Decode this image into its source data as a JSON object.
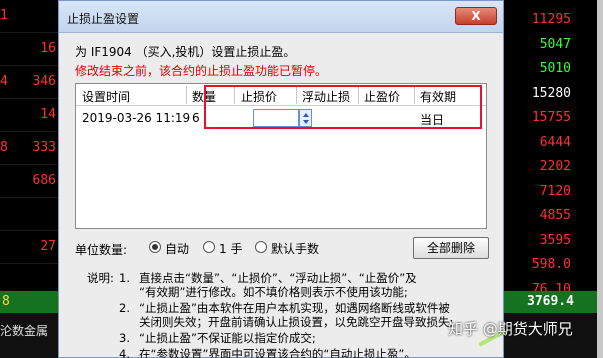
{
  "background": {
    "left_column": [
      {
        "idx": "1",
        "num": "",
        "color": "#ff3030"
      },
      {
        "idx": "",
        "num": "",
        "color": "#ff3030"
      },
      {
        "idx": "4",
        "num": "346",
        "color": "#ff3030"
      },
      {
        "idx": "",
        "num": "",
        "color": "#ff3030"
      },
      {
        "idx": "8",
        "num": "333",
        "color": "#ff3030"
      },
      {
        "idx": "",
        "num": "",
        "color": "#ff3030"
      },
      {
        "idx": "",
        "num": "",
        "color": "#ff3030"
      },
      {
        "idx": "",
        "num": "",
        "color": "#ff3030"
      },
      {
        "idx": "",
        "num": "",
        "color": "#ff3030"
      }
    ],
    "left_extra": [
      "16",
      "14",
      "686",
      "27"
    ],
    "right_column": [
      {
        "value": "11295",
        "color": "#ff3030"
      },
      {
        "value": "5047",
        "color": "#33ff33"
      },
      {
        "value": "5010",
        "color": "#33ff33"
      },
      {
        "value": "15280",
        "color": "#ffffff"
      },
      {
        "value": "15755",
        "color": "#ff3030"
      },
      {
        "value": "6444",
        "color": "#ff3030"
      },
      {
        "value": "2202",
        "color": "#ff3030"
      },
      {
        "value": "7120",
        "color": "#ff3030"
      },
      {
        "value": "4855",
        "color": "#ff3030"
      },
      {
        "value": "3595",
        "color": "#ff3030"
      },
      {
        "value": "598.0",
        "color": "#ff3030"
      },
      {
        "value": "76.10",
        "color": "#ff3030"
      },
      {
        "value": "3769.4",
        "color": "#ffffff"
      }
    ],
    "bottom_label": "沦数金属",
    "watermark": "知乎 @期货大师兄",
    "row_index_bottom": "8"
  },
  "dialog": {
    "title": "止损止盈设置",
    "close_label": "X",
    "info_line": "为 IF1904 （买入,投机）设置止损止盈。",
    "warning_line": "修改结束之前，该合约的止损止盈功能已暂停。",
    "table": {
      "headers": [
        "设置时间",
        "数量",
        "止损价",
        "浮动止损",
        "止盈价",
        "有效期"
      ],
      "rows": [
        {
          "time": "2019-03-26 11:19",
          "qty": "6",
          "stop_loss": "",
          "float_stop": "",
          "take_profit": "",
          "validity": "当日"
        }
      ]
    },
    "unit_label": "单位数量:",
    "unit_options": [
      {
        "label": "自动",
        "selected": true
      },
      {
        "label": "1 手",
        "selected": false
      },
      {
        "label": "默认手数",
        "selected": false
      }
    ],
    "delete_all": "全部删除",
    "notes_label": "说明:",
    "notes": [
      {
        "n": "1.",
        "lines": [
          "直接点击“数量”、“止损价”、“浮动止损”、“止盈价”及",
          "“有效期”进行修改。如不填价格则表示不使用该功能;"
        ]
      },
      {
        "n": "2.",
        "lines": [
          "“止损止盈”由本软件在用户本机实现，如遇网络断线或软件被",
          "关闭则失效；开盘前请确认止损设置，以免跳空开盘导致损失;"
        ]
      },
      {
        "n": "3.",
        "lines": [
          "“止损止盈”不保证能以指定价成交;"
        ]
      },
      {
        "n": "4.",
        "lines": [
          "在“参数设置”界面中可设置该合约的“自动止损止盈”。"
        ]
      }
    ]
  }
}
